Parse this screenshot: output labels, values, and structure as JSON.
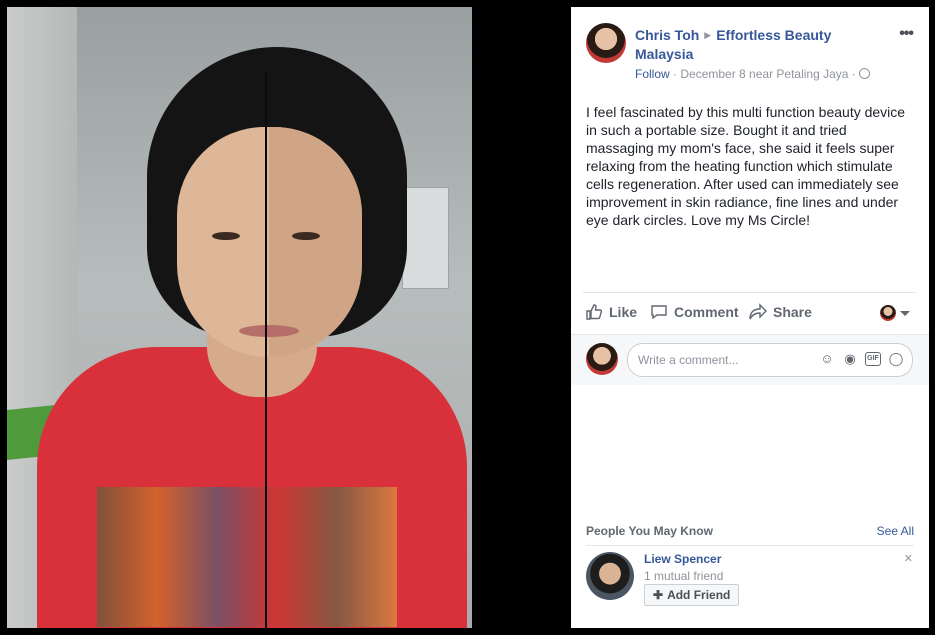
{
  "post": {
    "author": "Chris Toh",
    "page": "Effortless Beauty Malaysia",
    "follow": "Follow",
    "meta": "December 8 near Petaling Jaya ·",
    "meta_sep": " · ",
    "text": "I feel fascinated by this multi function beauty device in such a portable size. Bought it and tried massaging my mom's face, she said it feels super relaxing from the heating function which stimulate cells regeneration. After used can immediately see improvement in skin radiance, fine lines and under eye dark circles. Love my Ms Circle!"
  },
  "actions": {
    "like": "Like",
    "comment": "Comment",
    "share": "Share"
  },
  "comment_box": {
    "placeholder": "Write a comment..."
  },
  "pymk": {
    "title": "People You May Know",
    "see_all": "See All",
    "friend": {
      "name": "Liew Spencer",
      "mutual": "1 mutual friend",
      "add_label": "Add Friend"
    }
  },
  "icons": {
    "more": "more-options-icon",
    "globe": "globe-icon",
    "like": "thumbs-up-icon",
    "comment": "speech-bubble-icon",
    "share": "share-arrow-icon",
    "emoji": "emoji-icon",
    "camera": "camera-icon",
    "gif": "gif-icon",
    "sticker": "sticker-icon",
    "close": "close-icon"
  },
  "colors": {
    "link": "#365899",
    "muted": "#90949c",
    "text": "#1d2129"
  }
}
